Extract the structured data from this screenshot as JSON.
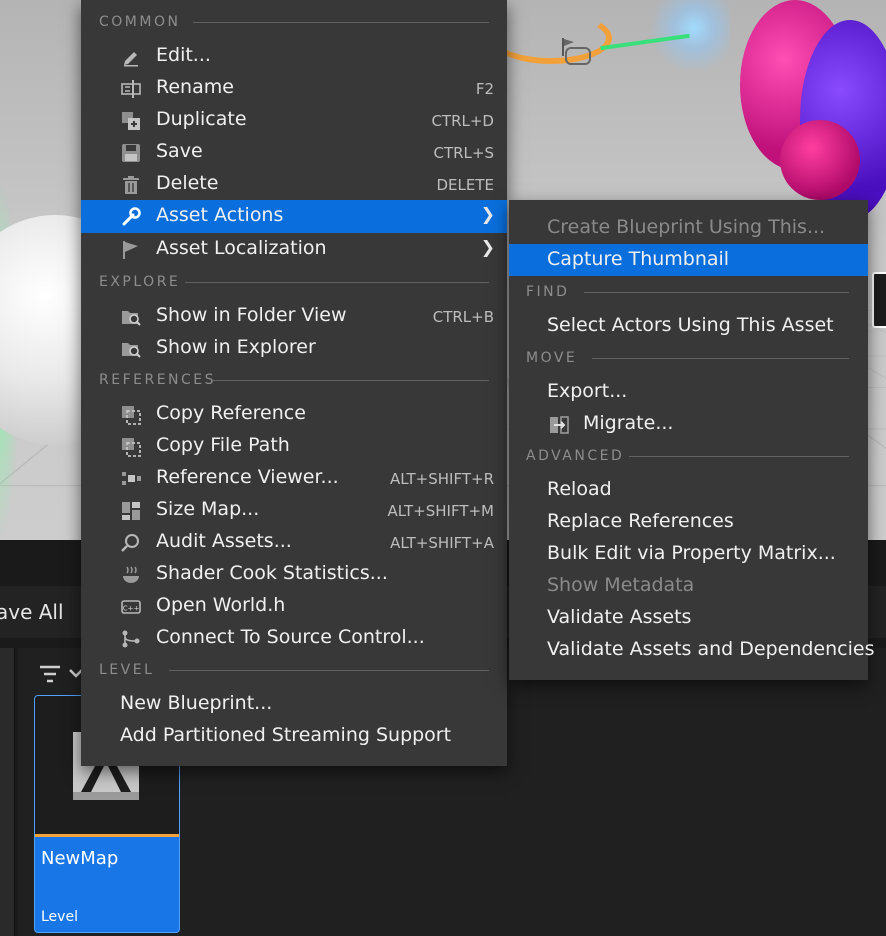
{
  "background": {
    "save_all_label": "ave All",
    "asset_tile": {
      "name": "NewMap",
      "type": "Level"
    }
  },
  "main_menu": {
    "sections": {
      "common": "COMMON",
      "explore": "EXPLORE",
      "references": "REFERENCES",
      "level": "LEVEL"
    },
    "items": [
      {
        "label": "Edit...",
        "shortcut": "",
        "icon": "pencil-icon"
      },
      {
        "label": "Rename",
        "shortcut": "F2",
        "icon": "rename-icon"
      },
      {
        "label": "Duplicate",
        "shortcut": "CTRL+D",
        "icon": "duplicate-icon"
      },
      {
        "label": "Save",
        "shortcut": "CTRL+S",
        "icon": "save-icon"
      },
      {
        "label": "Delete",
        "shortcut": "DELETE",
        "icon": "trash-icon"
      },
      {
        "label": "Asset Actions",
        "shortcut": "",
        "icon": "wrench-icon"
      },
      {
        "label": "Asset Localization",
        "shortcut": "",
        "icon": "flag-icon"
      },
      {
        "label": "Show in Folder View",
        "shortcut": "CTRL+B",
        "icon": "folder-search-icon"
      },
      {
        "label": "Show in Explorer",
        "shortcut": "",
        "icon": "folder-search-icon"
      },
      {
        "label": "Copy Reference",
        "shortcut": "",
        "icon": "copy-icon"
      },
      {
        "label": "Copy File Path",
        "shortcut": "",
        "icon": "copy-icon"
      },
      {
        "label": "Reference Viewer...",
        "shortcut": "ALT+SHIFT+R",
        "icon": "graph-icon"
      },
      {
        "label": "Size Map...",
        "shortcut": "ALT+SHIFT+M",
        "icon": "sizemap-icon"
      },
      {
        "label": "Audit Assets...",
        "shortcut": "ALT+SHIFT+A",
        "icon": "audit-icon"
      },
      {
        "label": "Shader Cook Statistics...",
        "shortcut": "",
        "icon": "cook-icon"
      },
      {
        "label": "Open World.h",
        "shortcut": "",
        "icon": "code-icon"
      },
      {
        "label": "Connect To Source Control...",
        "shortcut": "",
        "icon": "source-control-icon"
      },
      {
        "label": "New Blueprint...",
        "shortcut": "",
        "icon": ""
      },
      {
        "label": "Add Partitioned Streaming Support",
        "shortcut": "",
        "icon": ""
      }
    ]
  },
  "sub_menu": {
    "sections": {
      "find": "FIND",
      "move": "MOVE",
      "advanced": "ADVANCED"
    },
    "items": [
      {
        "label": "Create Blueprint Using This...",
        "disabled": true
      },
      {
        "label": "Capture Thumbnail",
        "disabled": false
      },
      {
        "label": "Select Actors Using This Asset",
        "disabled": false
      },
      {
        "label": "Export...",
        "disabled": false
      },
      {
        "label": "Migrate...",
        "disabled": false
      },
      {
        "label": "Reload",
        "disabled": false
      },
      {
        "label": "Replace References",
        "disabled": false
      },
      {
        "label": "Bulk Edit via Property Matrix...",
        "disabled": false
      },
      {
        "label": "Show Metadata",
        "disabled": true
      },
      {
        "label": "Validate Assets",
        "disabled": false
      },
      {
        "label": "Validate Assets and Dependencies",
        "disabled": false
      }
    ]
  },
  "colors": {
    "menu_bg": "#383838",
    "highlight": "#0a6fdc",
    "disabled_text": "#8a8a8a"
  }
}
